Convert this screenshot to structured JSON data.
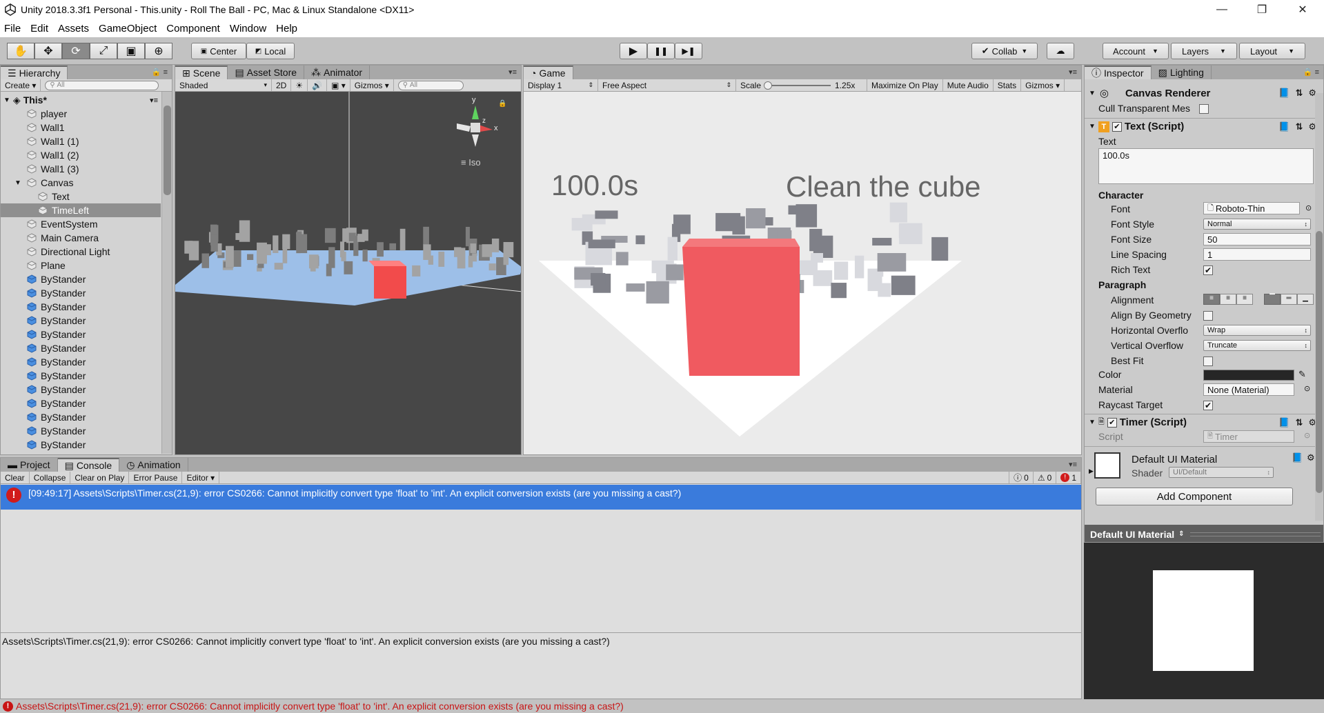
{
  "window": {
    "title": "Unity 2018.3.3f1 Personal - This.unity - Roll The Ball - PC, Mac & Linux Standalone <DX11>",
    "controls": [
      "—",
      "❐",
      "✕"
    ]
  },
  "menu": [
    "File",
    "Edit",
    "Assets",
    "GameObject",
    "Component",
    "Window",
    "Help"
  ],
  "toolbar": {
    "tools": [
      "hand-tool",
      "move-tool",
      "rotate-tool",
      "scale-tool",
      "rect-tool",
      "transform-tool"
    ],
    "pivot": "Center",
    "space": "Local",
    "play": "▶",
    "pause": "❚❚",
    "step": "▶❚",
    "collab": "Collab",
    "account": "Account",
    "layers": "Layers",
    "layout": "Layout"
  },
  "hierarchy": {
    "tab": "Hierarchy",
    "create": "Create",
    "search_placeholder": "All",
    "scene": "This*",
    "items": [
      {
        "label": "player",
        "blue": false,
        "indent": 1
      },
      {
        "label": "Wall1",
        "blue": false,
        "indent": 1
      },
      {
        "label": "Wall1 (1)",
        "blue": false,
        "indent": 1
      },
      {
        "label": "Wall1 (2)",
        "blue": false,
        "indent": 1
      },
      {
        "label": "Wall1 (3)",
        "blue": false,
        "indent": 1
      },
      {
        "label": "Canvas",
        "blue": false,
        "indent": 1
      },
      {
        "label": "Text",
        "blue": false,
        "indent": 2
      },
      {
        "label": "TimeLeft",
        "blue": false,
        "indent": 2
      },
      {
        "label": "EventSystem",
        "blue": false,
        "indent": 1
      },
      {
        "label": "Main Camera",
        "blue": false,
        "indent": 1
      },
      {
        "label": "Directional Light",
        "blue": false,
        "indent": 1
      },
      {
        "label": "Plane",
        "blue": false,
        "indent": 1
      },
      {
        "label": "ByStander",
        "blue": true,
        "indent": 1
      },
      {
        "label": "ByStander",
        "blue": true,
        "indent": 1
      },
      {
        "label": "ByStander",
        "blue": true,
        "indent": 1
      },
      {
        "label": "ByStander",
        "blue": true,
        "indent": 1
      },
      {
        "label": "ByStander",
        "blue": true,
        "indent": 1
      },
      {
        "label": "ByStander",
        "blue": true,
        "indent": 1
      },
      {
        "label": "ByStander",
        "blue": true,
        "indent": 1
      },
      {
        "label": "ByStander",
        "blue": true,
        "indent": 1
      },
      {
        "label": "ByStander",
        "blue": true,
        "indent": 1
      },
      {
        "label": "ByStander",
        "blue": true,
        "indent": 1
      },
      {
        "label": "ByStander",
        "blue": true,
        "indent": 1
      },
      {
        "label": "ByStander",
        "blue": true,
        "indent": 1
      },
      {
        "label": "ByStander",
        "blue": true,
        "indent": 1
      }
    ]
  },
  "scene": {
    "tabs": [
      "Scene",
      "Asset Store",
      "Animator"
    ],
    "shading": "Shaded",
    "mode2d": "2D",
    "gizmos": "Gizmos",
    "search_placeholder": "All",
    "gizmo_y": "y",
    "gizmo_x": "x",
    "gizmo_z": "z",
    "projection": "Iso"
  },
  "game": {
    "tab": "Game",
    "display": "Display 1",
    "aspect": "Free Aspect",
    "scale_label": "Scale",
    "scale_value": "1.25x",
    "maximize": "Maximize On Play",
    "mute": "Mute Audio",
    "stats": "Stats",
    "gizmos": "Gizmos",
    "timer_text": "100.0s",
    "goal_text": "Clean the cube"
  },
  "inspector": {
    "tabs": [
      "Inspector",
      "Lighting"
    ],
    "canvas_renderer": "Canvas Renderer",
    "cull_label": "Cull Transparent Mes",
    "text_component": "Text (Script)",
    "text_label": "Text",
    "text_value": "100.0s",
    "character": "Character",
    "font_label": "Font",
    "font_value": "Roboto-Thin",
    "font_style_label": "Font Style",
    "font_style_value": "Normal",
    "font_size_label": "Font Size",
    "font_size_value": "50",
    "line_spacing_label": "Line Spacing",
    "line_spacing_value": "1",
    "rich_text_label": "Rich Text",
    "paragraph": "Paragraph",
    "alignment_label": "Alignment",
    "align_geometry_label": "Align By Geometry",
    "h_overflow_label": "Horizontal Overflo",
    "h_overflow_value": "Wrap",
    "v_overflow_label": "Vertical Overflow",
    "v_overflow_value": "Truncate",
    "best_fit_label": "Best Fit",
    "color_label": "Color",
    "material_label": "Material",
    "material_value": "None (Material)",
    "raycast_label": "Raycast Target",
    "timer_component": "Timer (Script)",
    "script_label": "Script",
    "script_value": "Timer",
    "default_material": "Default UI Material",
    "shader_label": "Shader",
    "shader_value": "UI/Default",
    "add_component": "Add Component",
    "preview_title": "Default UI Material"
  },
  "console": {
    "tabs": [
      "Project",
      "Console",
      "Animation"
    ],
    "buttons": [
      "Clear",
      "Collapse",
      "Clear on Play",
      "Error Pause",
      "Editor"
    ],
    "info_count": "0",
    "warn_count": "0",
    "error_count": "1",
    "entry": "[09:49:17] Assets\\Scripts\\Timer.cs(21,9): error CS0266: Cannot implicitly convert type 'float' to 'int'. An explicit conversion exists (are you missing a cast?)",
    "detail": "Assets\\Scripts\\Timer.cs(21,9): error CS0266: Cannot implicitly convert type 'float' to 'int'. An explicit conversion exists (are you missing a cast?)"
  },
  "statusbar": {
    "message": "Assets\\Scripts\\Timer.cs(21,9): error CS0266: Cannot implicitly convert type 'float' to 'int'. An explicit conversion exists (are you missing a cast?)"
  },
  "colors": {
    "accent": "#3a7bdc",
    "error": "#d11b1b",
    "cube": "#f0585e",
    "editor_bg": "#c2c2c2"
  }
}
